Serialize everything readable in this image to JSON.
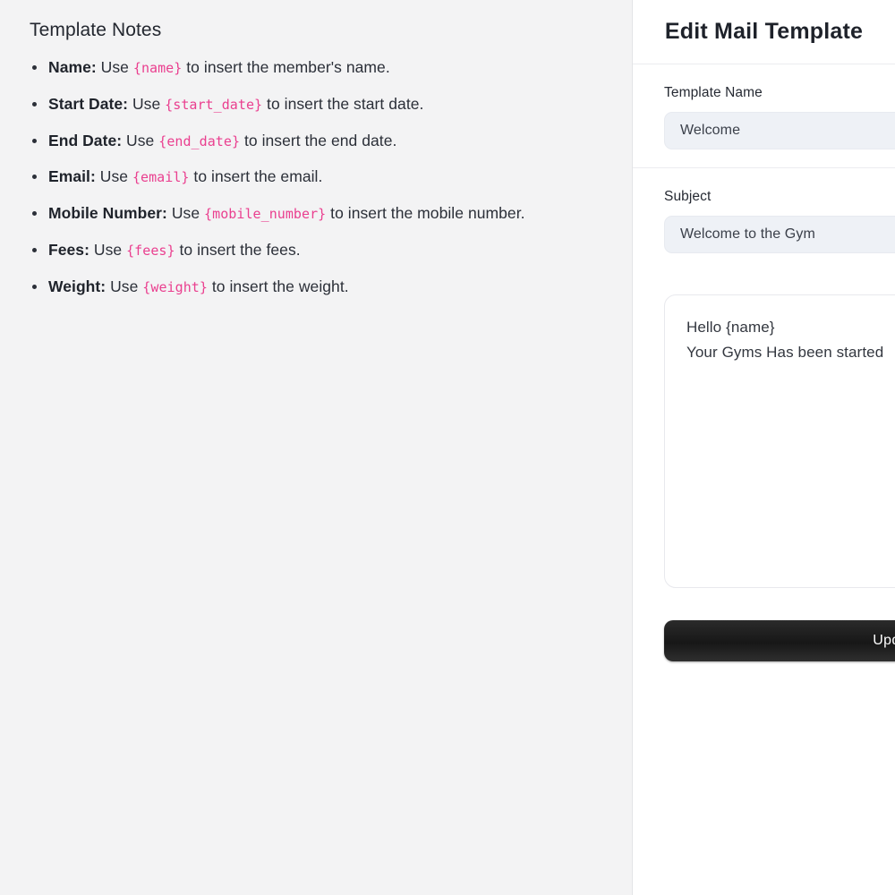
{
  "notes": {
    "title": "Template Notes",
    "items": [
      {
        "label": "Name:",
        "pre": "Use ",
        "variable": "{name}",
        "post": " to insert the member's name."
      },
      {
        "label": "Start Date:",
        "pre": "Use ",
        "variable": "{start_date}",
        "post": " to insert the start date."
      },
      {
        "label": "End Date:",
        "pre": "Use ",
        "variable": "{end_date}",
        "post": " to insert the end date."
      },
      {
        "label": "Email:",
        "pre": "Use ",
        "variable": "{email}",
        "post": " to insert the email."
      },
      {
        "label": "Mobile Number:",
        "pre": "Use ",
        "variable": "{mobile_number}",
        "post": " to insert the mobile number."
      },
      {
        "label": "Fees:",
        "pre": "Use ",
        "variable": "{fees}",
        "post": " to insert the fees."
      },
      {
        "label": "Weight:",
        "pre": "Use ",
        "variable": "{weight}",
        "post": " to insert the weight."
      }
    ]
  },
  "editor": {
    "title": "Edit Mail Template",
    "template_name": {
      "label": "Template Name",
      "value": "Welcome"
    },
    "subject": {
      "label": "Subject",
      "value": "Welcome to the Gym"
    },
    "body": {
      "value": "Hello {name}\nYour Gyms Has been started"
    },
    "submit_label": "Update"
  },
  "colors": {
    "variable_pink": "#ea3f8f",
    "panel_background": "#f3f3f4",
    "input_background": "#eef1f6",
    "button_background": "#171717",
    "heading_text": "#1e222a"
  }
}
